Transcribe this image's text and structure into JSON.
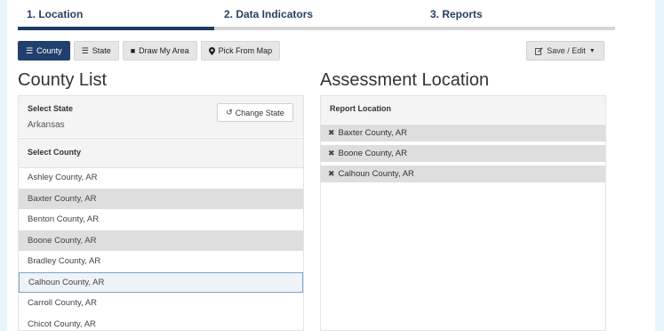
{
  "steps": [
    {
      "label": "1. Location"
    },
    {
      "label": "2. Data Indicators"
    },
    {
      "label": "3. Reports"
    }
  ],
  "toolbar": {
    "county": "County",
    "state": "State",
    "draw": "Draw My Area",
    "pick": "Pick From Map",
    "save_edit": "Save / Edit"
  },
  "left": {
    "title": "County List",
    "select_state_label": "Select State",
    "state_value": "Arkansas",
    "change_state": "Change State",
    "select_county_label": "Select County",
    "counties": [
      "Ashley County, AR",
      "Baxter County, AR",
      "Benton County, AR",
      "Boone County, AR",
      "Bradley County, AR",
      "Calhoun County, AR",
      "Carroll County, AR",
      "Chicot County, AR"
    ]
  },
  "right": {
    "title": "Assessment Location",
    "report_location_label": "Report Location",
    "selected": [
      "Baxter County, AR",
      "Boone County, AR",
      "Calhoun County, AR"
    ]
  },
  "icons": {
    "list": "list-icon",
    "square": "square-icon",
    "pin": "map-pin-icon",
    "edit": "edit-icon",
    "caret": "caret-down-icon",
    "refresh": "refresh-icon",
    "remove": "remove-icon"
  }
}
